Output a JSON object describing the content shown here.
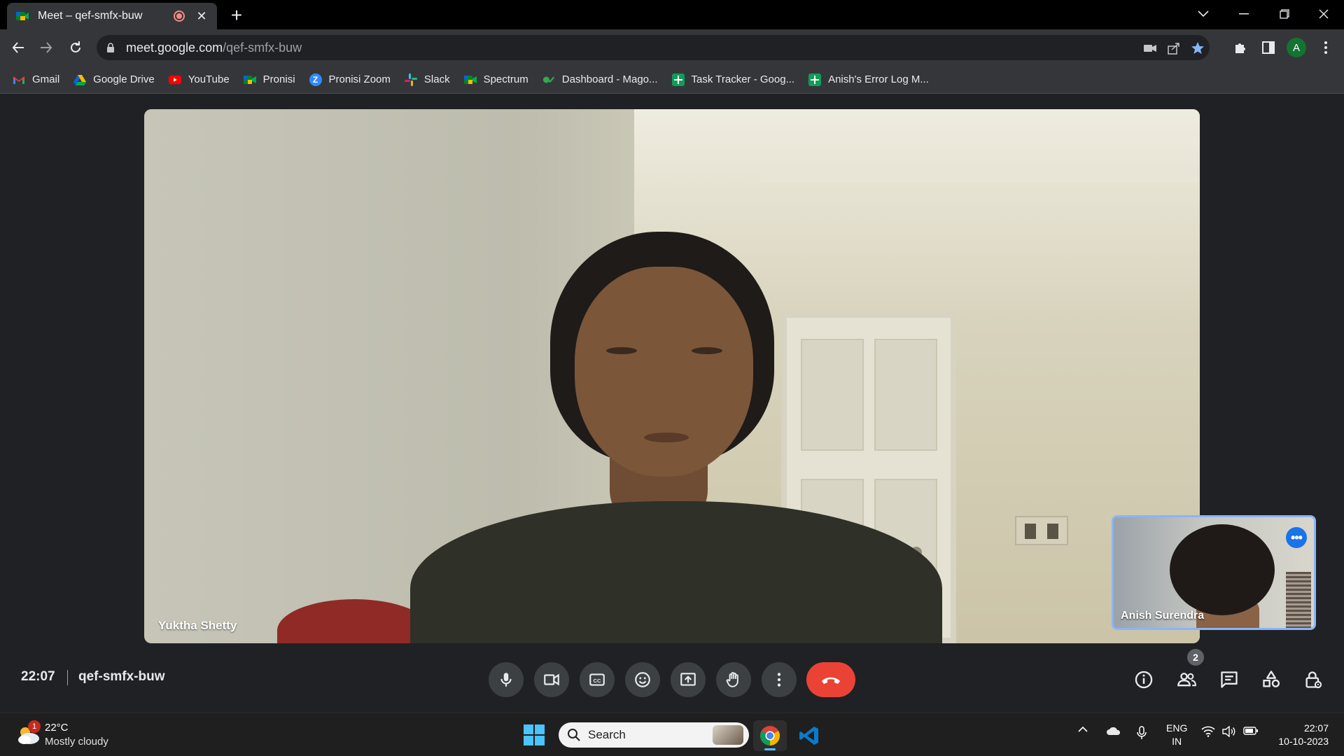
{
  "browser": {
    "tab_title": "Meet – qef-smfx-buw",
    "new_tab_label": "+",
    "url_host": "meet.google.com",
    "url_path": "/qef-smfx-buw",
    "profile_initial": "A"
  },
  "bookmarks": [
    {
      "label": "Gmail",
      "icon": "gmail-icon",
      "color": "#ea4335"
    },
    {
      "label": "Google Drive",
      "icon": "google-drive-icon",
      "color": "#34a853"
    },
    {
      "label": "YouTube",
      "icon": "youtube-icon",
      "color": "#ff0000"
    },
    {
      "label": "Pronisi",
      "icon": "meet-icon",
      "color": "#00832d"
    },
    {
      "label": "Pronisi Zoom",
      "icon": "zoom-icon",
      "color": "#2d8cff"
    },
    {
      "label": "Slack",
      "icon": "slack-icon",
      "color": "#e01e5a"
    },
    {
      "label": "Spectrum",
      "icon": "meet-icon",
      "color": "#00832d"
    },
    {
      "label": "Dashboard - Mago...",
      "icon": "dashboard-icon",
      "color": "#34a853"
    },
    {
      "label": "Task Tracker - Goog...",
      "icon": "sheets-icon",
      "color": "#0f9d58"
    },
    {
      "label": "Anish's Error Log M...",
      "icon": "sheets-icon",
      "color": "#0f9d58"
    }
  ],
  "meet": {
    "main_participant": "Yuktha Shetty",
    "self_participant": "Anish Surendra",
    "time": "22:07",
    "meeting_code": "qef-smfx-buw",
    "people_count": "2",
    "end_call_color": "#ea4335",
    "accent_color": "#8ab4f8"
  },
  "taskbar": {
    "weather_badge": "1",
    "temperature": "22°C",
    "weather_desc": "Mostly cloudy",
    "search_placeholder": "Search",
    "lang_line1": "ENG",
    "lang_line2": "IN",
    "clock_time": "22:07",
    "clock_date": "10-10-2023"
  }
}
